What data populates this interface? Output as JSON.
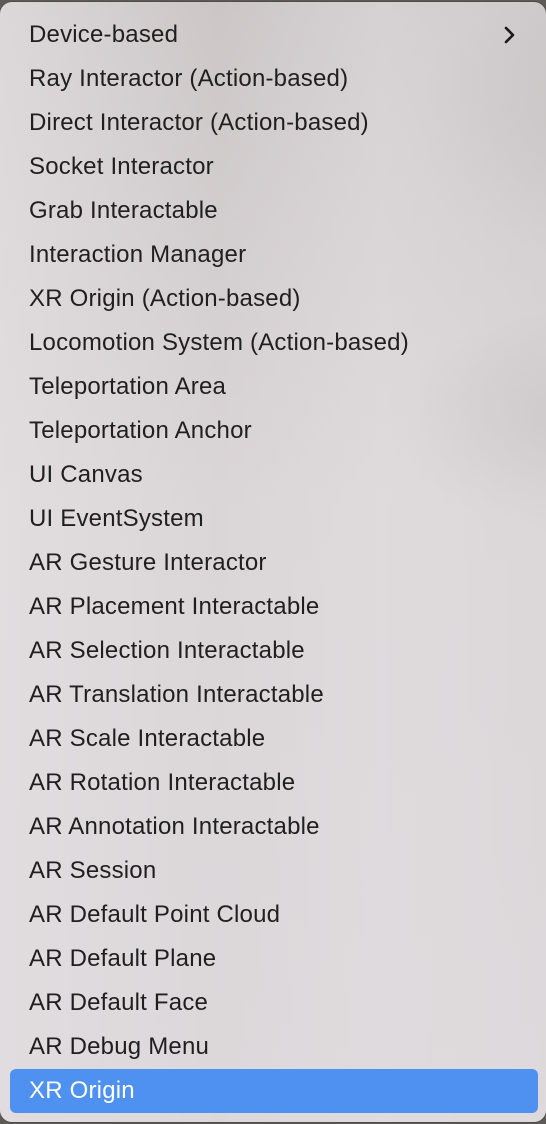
{
  "menu": {
    "items": [
      {
        "label": "Device-based",
        "submenu": true
      },
      {
        "label": "Ray Interactor (Action-based)"
      },
      {
        "label": "Direct Interactor (Action-based)"
      },
      {
        "label": "Socket Interactor"
      },
      {
        "label": "Grab Interactable"
      },
      {
        "label": "Interaction Manager"
      },
      {
        "label": "XR Origin (Action-based)"
      },
      {
        "label": "Locomotion System (Action-based)"
      },
      {
        "label": "Teleportation Area"
      },
      {
        "label": "Teleportation Anchor"
      },
      {
        "label": "UI Canvas"
      },
      {
        "label": "UI EventSystem"
      },
      {
        "label": "AR Gesture Interactor"
      },
      {
        "label": "AR Placement Interactable"
      },
      {
        "label": "AR Selection Interactable"
      },
      {
        "label": "AR Translation Interactable"
      },
      {
        "label": "AR Scale Interactable"
      },
      {
        "label": "AR Rotation Interactable"
      },
      {
        "label": "AR Annotation Interactable"
      },
      {
        "label": "AR Session"
      },
      {
        "label": "AR Default Point Cloud"
      },
      {
        "label": "AR Default Plane"
      },
      {
        "label": "AR Default Face"
      },
      {
        "label": "AR Debug Menu"
      },
      {
        "label": "XR Origin",
        "selected": true
      }
    ],
    "highlight_color": "#4f91f0"
  }
}
